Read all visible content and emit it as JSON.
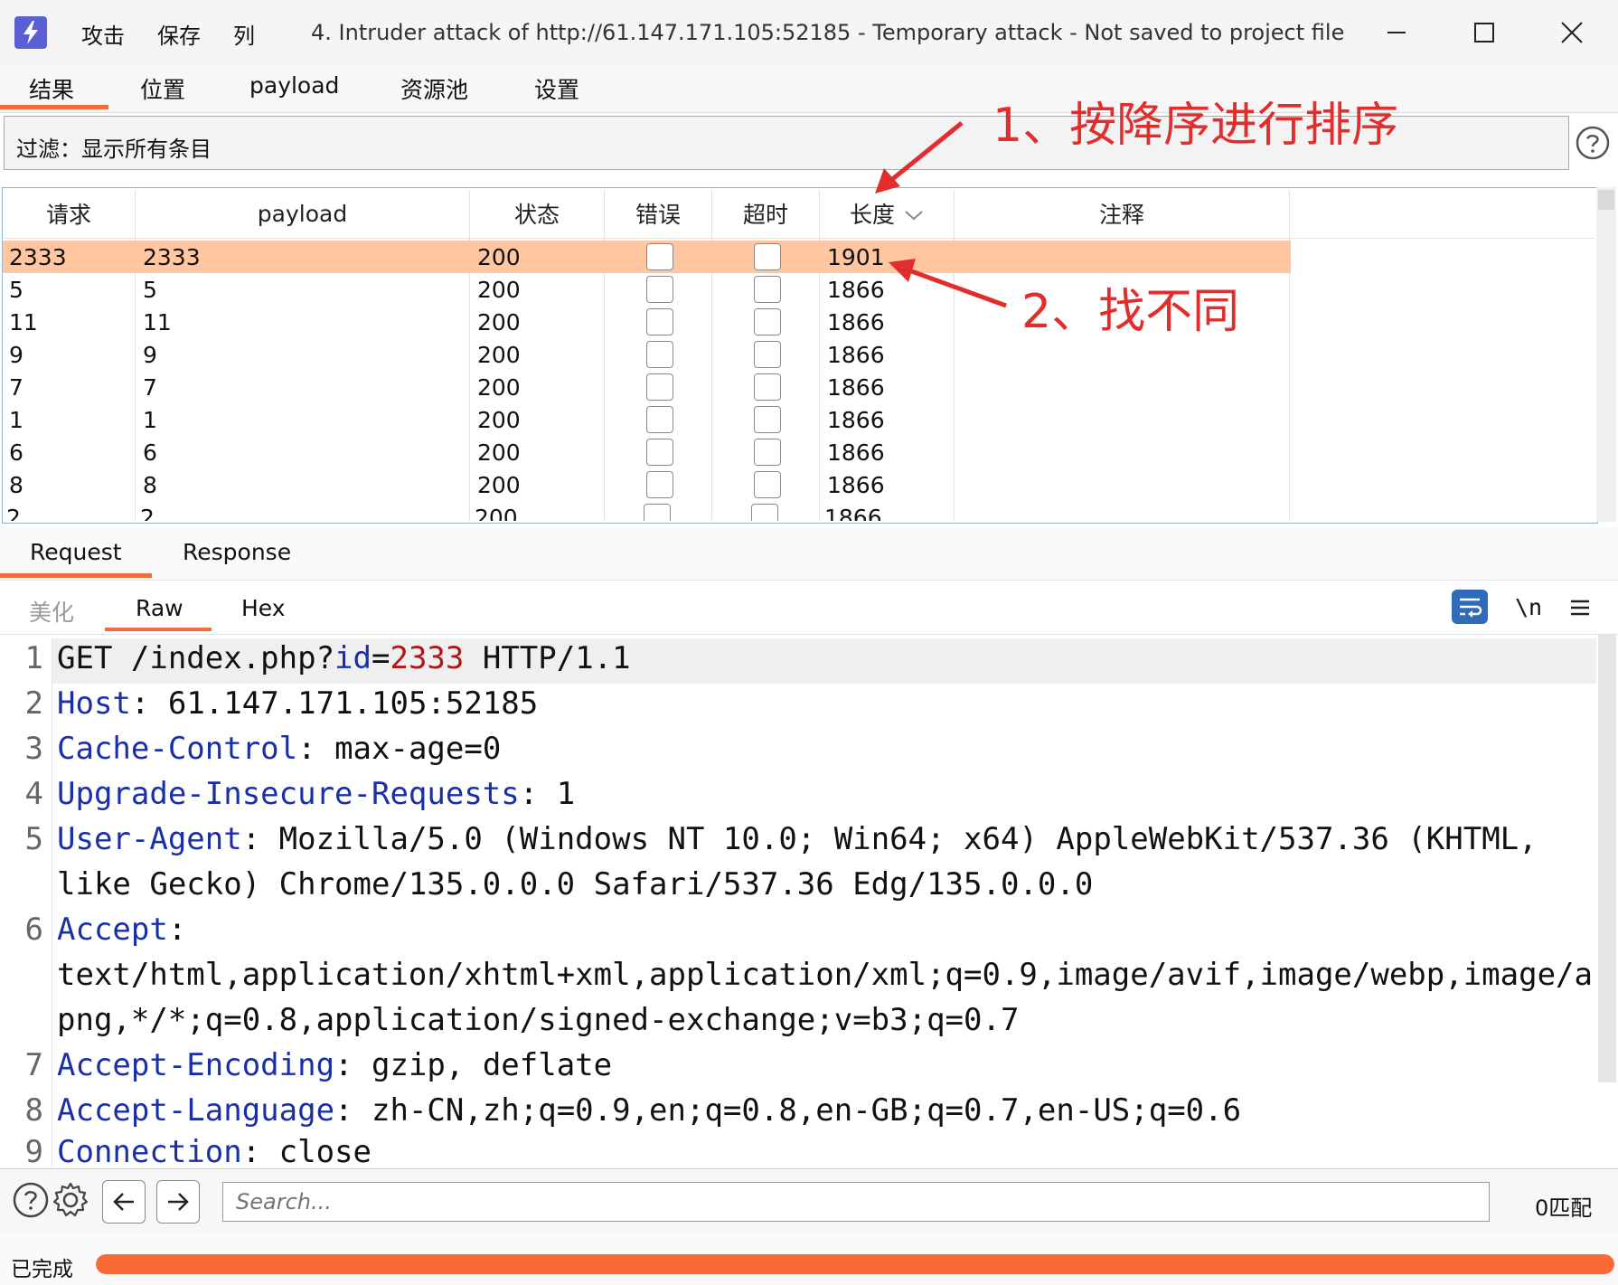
{
  "titlebar": {
    "menu": [
      "攻击",
      "保存",
      "列"
    ],
    "title": "4. Intruder attack of http://61.147.171.105:52185 - Temporary attack - Not saved to project file",
    "controls": [
      "minimize-icon",
      "maximize-icon",
      "close-icon"
    ]
  },
  "tabs": [
    "结果",
    "位置",
    "payload",
    "资源池",
    "设置"
  ],
  "active_tab": "结果",
  "filter": {
    "text": "过滤：显示所有条目"
  },
  "table": {
    "headers": [
      "请求",
      "payload",
      "状态",
      "错误",
      "超时",
      "长度",
      "注释"
    ],
    "sort_column": "长度",
    "sort_direction": "descending",
    "rows": [
      {
        "req": "2333",
        "payload": "2333",
        "status": "200",
        "length": "1901",
        "selected": true
      },
      {
        "req": "5",
        "payload": "5",
        "status": "200",
        "length": "1866"
      },
      {
        "req": "11",
        "payload": "11",
        "status": "200",
        "length": "1866"
      },
      {
        "req": "9",
        "payload": "9",
        "status": "200",
        "length": "1866"
      },
      {
        "req": "7",
        "payload": "7",
        "status": "200",
        "length": "1866"
      },
      {
        "req": "1",
        "payload": "1",
        "status": "200",
        "length": "1866"
      },
      {
        "req": "6",
        "payload": "6",
        "status": "200",
        "length": "1866"
      },
      {
        "req": "8",
        "payload": "8",
        "status": "200",
        "length": "1866"
      },
      {
        "req": "2",
        "payload": "2",
        "status": "200",
        "length": "1866"
      }
    ]
  },
  "annotations": {
    "step1": "1、按降序进行排序",
    "step2": "2、找不同",
    "color": "#e22d2d"
  },
  "rr_tabs": [
    "Request",
    "Response"
  ],
  "active_rr_tab": "Request",
  "sub_tabs": [
    "美化",
    "Raw",
    "Hex"
  ],
  "active_sub_tab": "Raw",
  "editor_tools": {
    "wrap_icon": "wrap-lines-icon",
    "newline_label": "\\n",
    "menu_icon": "hamburger-menu-icon"
  },
  "request_lines": [
    {
      "n": "1",
      "method": "GET /index.php?",
      "param_key": "id",
      "eq": "=",
      "param_val": "2333",
      "tail": " HTTP/1.1"
    },
    {
      "n": "2",
      "key": "Host",
      "sep": ": ",
      "value": "61.147.171.105:52185"
    },
    {
      "n": "3",
      "key": "Cache-Control",
      "sep": ": ",
      "value": "max-age=0"
    },
    {
      "n": "4",
      "key": "Upgrade-Insecure-Requests",
      "sep": ": ",
      "value": "1"
    },
    {
      "n": "5",
      "key": "User-Agent",
      "sep": ": ",
      "value": "Mozilla/5.0 (Windows NT 10.0; Win64; x64) AppleWebKit/537.36 (KHTML,",
      "cont": [
        "like Gecko) Chrome/135.0.0.0 Safari/537.36 Edg/135.0.0.0"
      ]
    },
    {
      "n": "6",
      "key": "Accept",
      "sep": ":",
      "value": "",
      "cont": [
        "text/html,application/xhtml+xml,application/xml;q=0.9,image/avif,image/webp,image/a",
        "png,*/*;q=0.8,application/signed-exchange;v=b3;q=0.7"
      ]
    },
    {
      "n": "7",
      "key": "Accept-Encoding",
      "sep": ": ",
      "value": "gzip, deflate"
    },
    {
      "n": "8",
      "key": "Accept-Language",
      "sep": ": ",
      "value": "zh-CN,zh;q=0.9,en;q=0.8,en-GB;q=0.7,en-US;q=0.6"
    },
    {
      "n": "9",
      "key": "Connection",
      "sep": ": ",
      "value": "close"
    }
  ],
  "search": {
    "placeholder": "Search...",
    "match_count": "0匹配"
  },
  "status": {
    "text": "已完成",
    "progress": 1.0,
    "accent": "#fb6a35"
  }
}
